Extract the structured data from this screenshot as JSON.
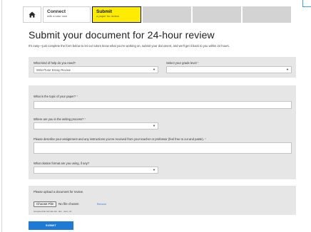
{
  "tabs": {
    "home_icon": "home-icon",
    "connect": {
      "title": "Connect",
      "subtitle": "with a tutor now"
    },
    "submit": {
      "title": "Submit",
      "subtitle": "a paper for review"
    }
  },
  "page": {
    "title": "Submit your document for 24-hour review",
    "intro": "It's easy—just complete the form below to let our tutors know what you're working on, submit your document, and we'll get it back to you within 24 hours."
  },
  "help": {
    "label": "What kind of help do you need?",
    "value": "Write!Tutor Essay Review"
  },
  "grade": {
    "label": "Select your grade level",
    "required": "*",
    "value": ""
  },
  "topic": {
    "label": "What is the topic of your paper?",
    "required": "*"
  },
  "process": {
    "label": "Where are you in the writing process?",
    "required": "*"
  },
  "assignment": {
    "label": "Please describe your assignment and any instructions you've received from your teacher or professor (feel free to cut and paste).",
    "required": "*"
  },
  "citation": {
    "label": "What citation format are you using, if any?"
  },
  "upload": {
    "label": "Please upload a document for review.",
    "choose_label": "Choose File",
    "no_file": "No file chosen",
    "remove_label": "Remove",
    "accepted": "Accepted file formats are .doc, .docx, txt"
  },
  "submit_label": "SUBMIT",
  "colors": {
    "active_tab": "#ffec00",
    "panel": "#e6e6e6",
    "submit_button": "#1f7ad6",
    "required": "#d9534f"
  }
}
